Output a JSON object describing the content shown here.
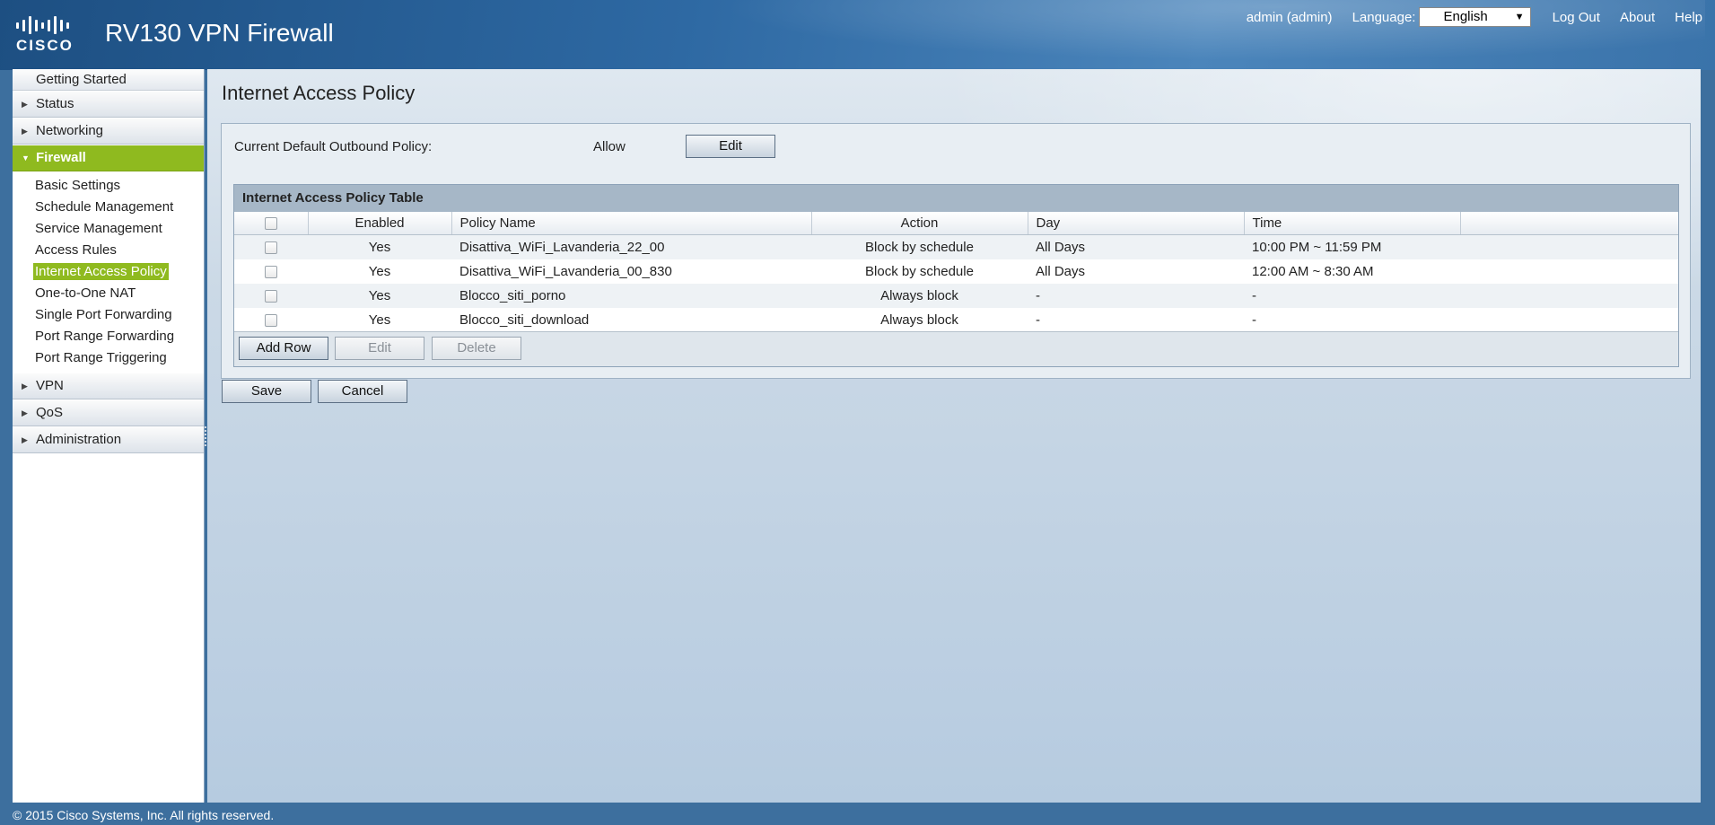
{
  "header": {
    "logo_text": "CISCO",
    "app_title": "RV130 VPN Firewall",
    "user": "admin (admin)",
    "language_label": "Language:",
    "language_value": "English",
    "logout": "Log Out",
    "about": "About",
    "help": "Help"
  },
  "sidebar": {
    "getting_started": "Getting Started",
    "groups_before": [
      {
        "label": "Status"
      },
      {
        "label": "Networking"
      }
    ],
    "firewall": {
      "label": "Firewall",
      "items": [
        {
          "label": "Basic Settings"
        },
        {
          "label": "Schedule Management"
        },
        {
          "label": "Service Management"
        },
        {
          "label": "Access Rules"
        },
        {
          "label": "Internet Access Policy"
        },
        {
          "label": "One-to-One NAT"
        },
        {
          "label": "Single Port Forwarding"
        },
        {
          "label": "Port Range Forwarding"
        },
        {
          "label": "Port Range Triggering"
        }
      ]
    },
    "groups_after": [
      {
        "label": "VPN"
      },
      {
        "label": "QoS"
      },
      {
        "label": "Administration"
      }
    ]
  },
  "main": {
    "page_title": "Internet Access Policy",
    "outbound_label": "Current Default Outbound Policy:",
    "outbound_value": "Allow",
    "edit_policy_button": "Edit",
    "table": {
      "caption": "Internet Access Policy Table",
      "columns": [
        "Enabled",
        "Policy Name",
        "Action",
        "Day",
        "Time"
      ],
      "rows": [
        {
          "enabled": "Yes",
          "policy_name": "Disattiva_WiFi_Lavanderia_22_00",
          "action": "Block by schedule",
          "day": "All Days",
          "time": "10:00 PM ~ 11:59 PM"
        },
        {
          "enabled": "Yes",
          "policy_name": "Disattiva_WiFi_Lavanderia_00_830",
          "action": "Block by schedule",
          "day": "All Days",
          "time": "12:00 AM ~ 8:30 AM"
        },
        {
          "enabled": "Yes",
          "policy_name": "Blocco_siti_porno",
          "action": "Always block",
          "day": "-",
          "time": "-"
        },
        {
          "enabled": "Yes",
          "policy_name": "Blocco_siti_download",
          "action": "Always block",
          "day": "-",
          "time": "-"
        }
      ],
      "add_row": "Add Row",
      "edit": "Edit",
      "delete": "Delete"
    },
    "save": "Save",
    "cancel": "Cancel"
  },
  "footer": {
    "copyright": "© 2015 Cisco Systems, Inc. All rights reserved."
  },
  "colors": {
    "accent_green": "#8fba1f",
    "header_blue": "#2e69a3"
  }
}
